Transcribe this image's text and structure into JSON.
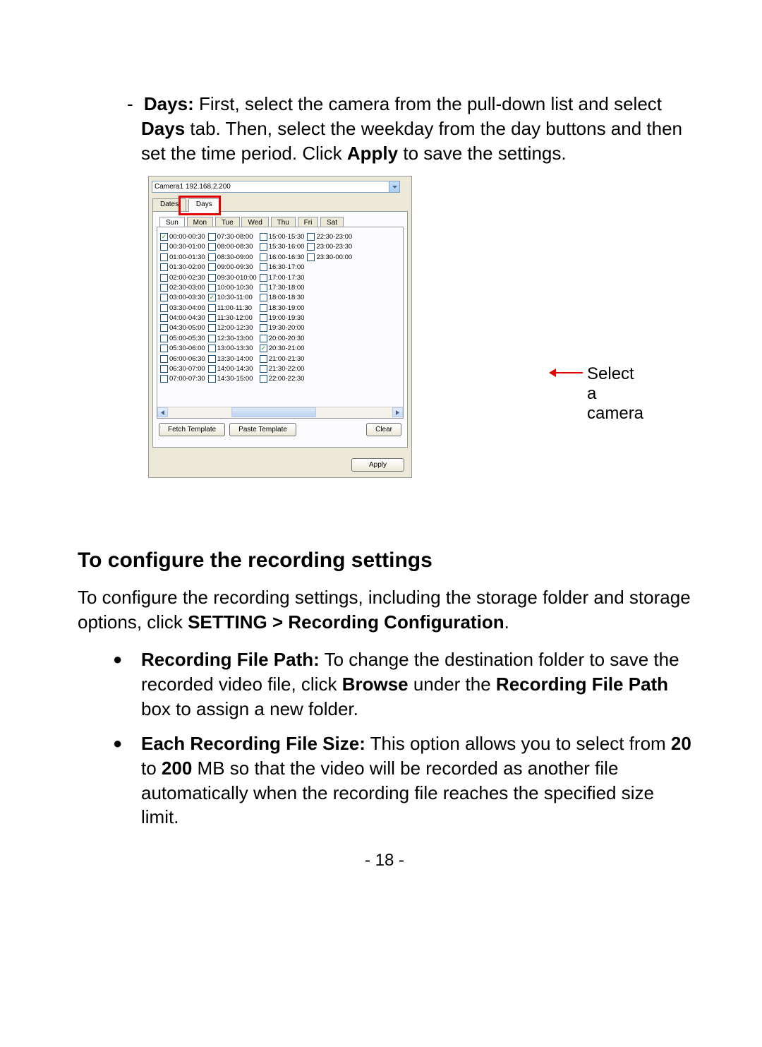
{
  "intro": {
    "dash": "-",
    "label": "Days:",
    "text1": " First, select the camera from the pull-down list and select ",
    "label2": "Days",
    "text2": " tab. Then, select the weekday from the day buttons and then set the time period. Click ",
    "label3": "Apply",
    "text3": " to save the settings."
  },
  "callout": "Select a camera",
  "shot": {
    "camera": "Camera1 192.168.2.200",
    "tabs": {
      "dates": "Dates",
      "days": "Days"
    },
    "day_tabs": [
      "Sun",
      "Mon",
      "Tue",
      "Wed",
      "Thu",
      "Fri",
      "Sat"
    ],
    "col1": [
      "00:00-00:30",
      "00:30-01:00",
      "01:00-01:30",
      "01:30-02:00",
      "02:00-02:30",
      "02:30-03:00",
      "03:00-03:30",
      "03:30-04:00",
      "04:00-04:30",
      "04:30-05:00",
      "05:00-05:30",
      "05:30-06:00",
      "06:00-06:30",
      "06:30-07:00",
      "07:00-07:30"
    ],
    "col2": [
      "07:30-08:00",
      "08:00-08:30",
      "08:30-09:00",
      "09:00-09:30",
      "09:30-010:00",
      "10:00-10:30",
      "10:30-11:00",
      "11:00-11:30",
      "11:30-12:00",
      "12:00-12:30",
      "12:30-13:00",
      "13:00-13:30",
      "13:30-14:00",
      "14:00-14:30",
      "14:30-15:00"
    ],
    "col3": [
      "15:00-15:30",
      "15:30-16:00",
      "16:00-16:30",
      "16:30-17:00",
      "17:00-17:30",
      "17:30-18:00",
      "18:00-18:30",
      "18:30-19:00",
      "19:00-19:30",
      "19:30-20:00",
      "20:00-20:30",
      "20:30-21:00",
      "21:00-21:30",
      "21:30-22:00",
      "22:00-22:30"
    ],
    "col4": [
      "22:30-23:00",
      "23:00-23:30",
      "23:30-00:00"
    ],
    "checked": {
      "col1": [
        0
      ],
      "col2": [
        6
      ],
      "col3": [
        11
      ],
      "col4": []
    },
    "buttons": {
      "fetch": "Fetch Template",
      "paste": "Paste Template",
      "clear": "Clear",
      "apply": "Apply"
    }
  },
  "section": {
    "heading": "To configure the recording settings",
    "para": {
      "t1": "To configure the recording settings, including the storage folder and storage options, click ",
      "b1": "SETTING > Recording Configuration",
      "t2": "."
    },
    "bullets": [
      {
        "b1": "Recording File Path:",
        "t1": " To change the destination folder to save the recorded video file, click ",
        "b2": "Browse",
        "t2": " under the ",
        "b3": "Recording File Path",
        "t3": " box to assign a new folder."
      },
      {
        "b1": "Each Recording File Size:",
        "t1": " This option allows you to select from ",
        "b2": "20",
        "t2": " to ",
        "b3": "200",
        "t3": " MB so that the video will be recorded as another file automatically when the recording file reaches the specified size limit."
      }
    ]
  },
  "pagenum": "- 18 -"
}
